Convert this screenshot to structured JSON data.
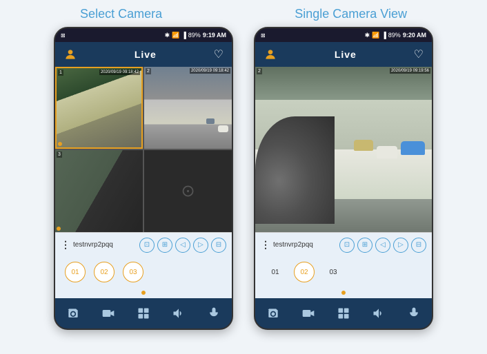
{
  "leftPanel": {
    "title": "Select Camera",
    "statusBar": {
      "time": "9:19 AM",
      "battery": "89%",
      "signal": "▂▄▆"
    },
    "header": {
      "title": "Live"
    },
    "device": {
      "name": "testnvrp2pqq"
    },
    "cameras": [
      {
        "id": "01",
        "selected": false
      },
      {
        "id": "02",
        "selected": false
      },
      {
        "id": "03",
        "selected": false
      }
    ],
    "controlIcons": [
      "screen-icon",
      "grid-icon",
      "prev-icon",
      "next-icon",
      "layout-icon"
    ],
    "navIcons": [
      "camera-icon",
      "video-icon",
      "grid-icon",
      "speaker-icon",
      "mic-icon"
    ],
    "timestamp1": "2020/09/19 09:18:42",
    "timestamp2": "2020/09/19 09:18:42"
  },
  "rightPanel": {
    "title": "Single Camera View",
    "statusBar": {
      "time": "9:20 AM",
      "battery": "89%"
    },
    "header": {
      "title": "Live"
    },
    "device": {
      "name": "testnvrp2pqq"
    },
    "cameras": [
      {
        "id": "01",
        "selected": false
      },
      {
        "id": "02",
        "selected": true
      },
      {
        "id": "03",
        "selected": false
      }
    ],
    "controlIcons": [
      "screen-icon",
      "grid-icon",
      "prev-icon",
      "next-icon",
      "layout-icon"
    ],
    "navIcons": [
      "camera-icon",
      "video-icon",
      "grid-icon",
      "speaker-icon",
      "mic-icon"
    ],
    "timestamp": "2020/09/19 09:19:56"
  },
  "colors": {
    "accent": "#e8a020",
    "blue": "#4a9fd4",
    "darkBlue": "#1a3a5c",
    "navBg": "#1a1a2e"
  }
}
